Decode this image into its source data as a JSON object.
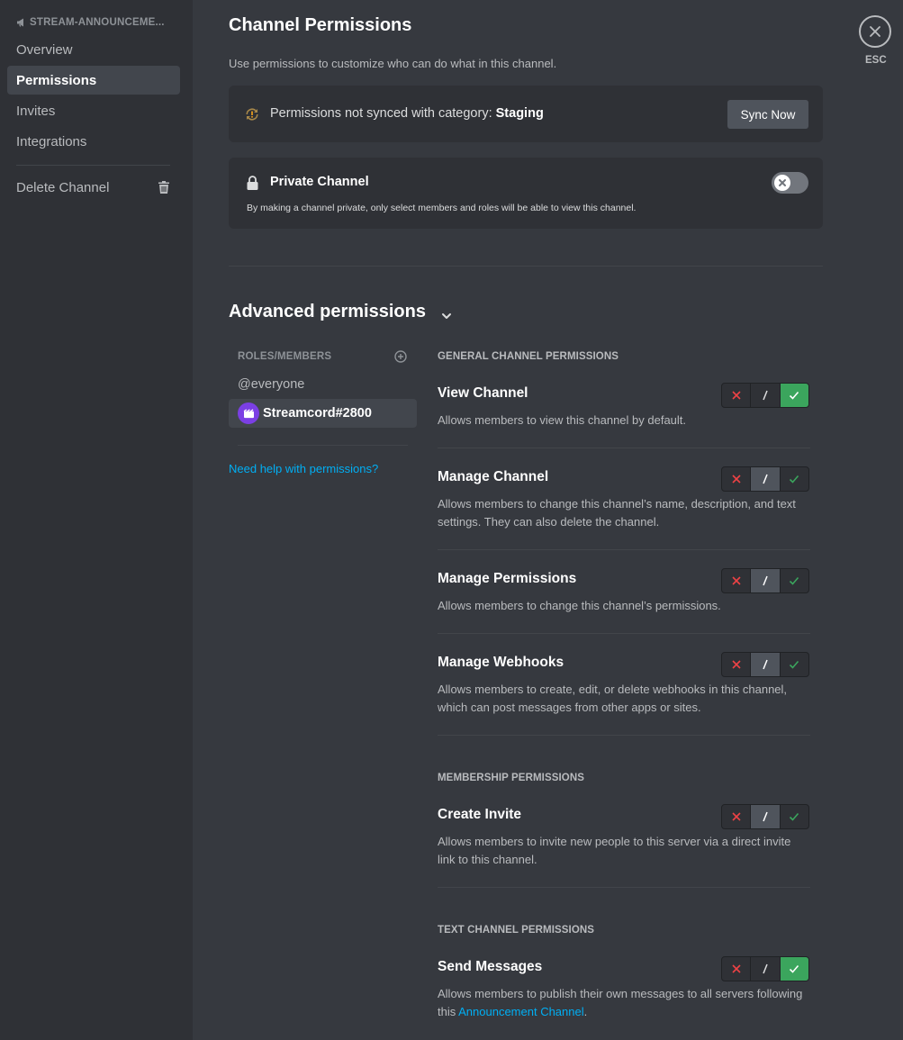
{
  "sidebar": {
    "channel_name": "STREAM-ANNOUNCEME...",
    "items": [
      {
        "label": "Overview"
      },
      {
        "label": "Permissions"
      },
      {
        "label": "Invites"
      },
      {
        "label": "Integrations"
      },
      {
        "label": "Delete Channel"
      }
    ]
  },
  "main": {
    "title": "Channel Permissions",
    "description": "Use permissions to customize who can do what in this channel.",
    "sync": {
      "message": "Permissions not synced with category: ",
      "category": "Staging",
      "button": "Sync Now"
    },
    "private": {
      "title": "Private Channel",
      "description": "By making a channel private, only select members and roles will be able to view this channel.",
      "enabled": false
    },
    "advanced_title": "Advanced permissions",
    "roles": {
      "header": "ROLES/MEMBERS",
      "items": [
        {
          "label": "@everyone"
        },
        {
          "label": "Streamcord#2800"
        }
      ],
      "help_link": "Need help with permissions?"
    },
    "sections": [
      {
        "header": "GENERAL CHANNEL PERMISSIONS"
      },
      {
        "header": "MEMBERSHIP PERMISSIONS"
      },
      {
        "header": "TEXT CHANNEL PERMISSIONS"
      }
    ],
    "permissions": [
      {
        "title": "View Channel",
        "description": "Allows members to view this channel by default.",
        "state": "allow"
      },
      {
        "title": "Manage Channel",
        "description": "Allows members to change this channel’s name, description, and text settings. They can also delete the channel.",
        "state": "neutral"
      },
      {
        "title": "Manage Permissions",
        "description": "Allows members to change this channel’s permissions.",
        "state": "neutral"
      },
      {
        "title": "Manage Webhooks",
        "description": "Allows members to create, edit, or delete webhooks in this channel, which can post messages from other apps or sites.",
        "state": "neutral"
      },
      {
        "title": "Create Invite",
        "description": "Allows members to invite new people to this server via a direct invite link to this channel.",
        "state": "neutral"
      },
      {
        "title": "Send Messages",
        "description_prefix": "Allows members to publish their own messages to all servers following this ",
        "description_link": "Announcement Channel",
        "description_suffix": ".",
        "state": "allow"
      }
    ],
    "tri_symbols": {
      "deny": "✕",
      "neutral": "/",
      "allow": "✓"
    }
  },
  "close": {
    "label": "ESC"
  },
  "colors": {
    "allow": "#3ba55d",
    "deny": "#ed4245",
    "link": "#00aff4",
    "accent_role": "#7b3fe4"
  }
}
